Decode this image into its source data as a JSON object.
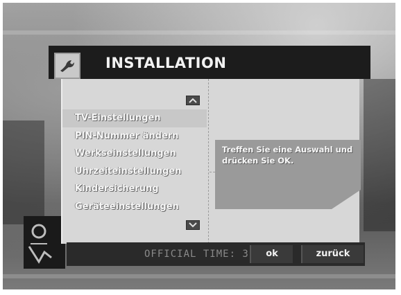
{
  "header": {
    "title": "INSTALLATION",
    "icon": "wrench-icon"
  },
  "menu": {
    "items": [
      {
        "label": "TV-Einstellungen",
        "selected": true
      },
      {
        "label": "PIN-Nummer ändern",
        "selected": false
      },
      {
        "label": "Werkseinstellungen",
        "selected": false
      },
      {
        "label": "Uhrzeiteinstellungen",
        "selected": false
      },
      {
        "label": "Kindersicherung",
        "selected": false
      },
      {
        "label": "Geräteeinstellungen",
        "selected": false
      }
    ],
    "scroll_up_icon": "chevron-up-icon",
    "scroll_down_icon": "chevron-down-icon"
  },
  "info": {
    "text": "Treffen Sie eine Auswahl und drücken Sie OK."
  },
  "footer": {
    "official_time": "OFFICIAL TIME: 3",
    "ok_label": "ok",
    "back_label": "zurück"
  },
  "colors": {
    "header_bg": "#1c1c1c",
    "panel_bg": "#d7d7d7",
    "selected_bg": "#c8c8c8",
    "info_bg": "#9a9a9a"
  }
}
